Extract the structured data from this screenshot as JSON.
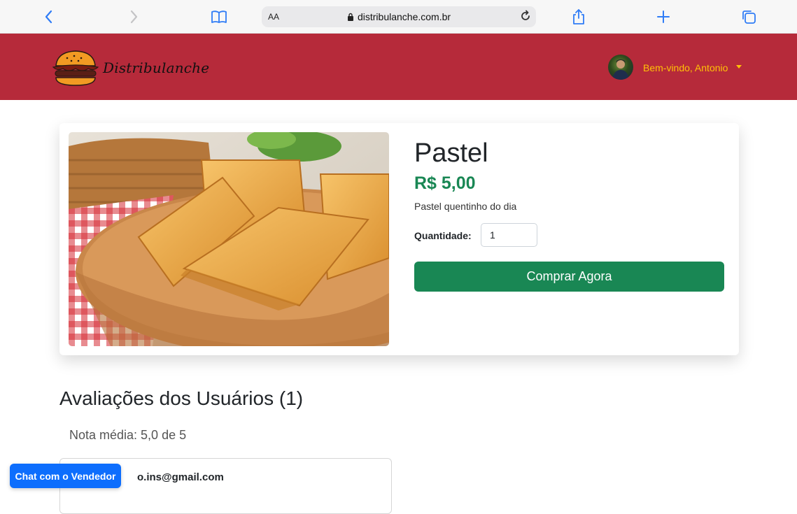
{
  "browser": {
    "url": "distribulanche.com.br",
    "aa_label": "AA",
    "icons": [
      "back-icon",
      "forward-icon",
      "bookmarks-icon",
      "lock-icon",
      "reload-icon",
      "share-icon",
      "new-tab-icon",
      "tabs-icon"
    ]
  },
  "header": {
    "brand": "Distribulanche",
    "greeting": "Bem-vindo, Antonio",
    "colors": {
      "background": "#b62a3a",
      "greeting": "#ffc107"
    }
  },
  "product": {
    "title": "Pastel",
    "price": "R$ 5,00",
    "description": "Pastel quentinho do dia",
    "quantity_label": "Quantidade:",
    "quantity_value": "1",
    "buy_label": "Comprar Agora",
    "colors": {
      "price": "#198754",
      "buy_button": "#198754"
    }
  },
  "reviews": {
    "title": "Avaliações dos Usuários (1)",
    "average": "Nota média: 5,0 de 5",
    "items": [
      {
        "author": "o.ins@gmail.com"
      }
    ]
  },
  "chat": {
    "label": "Chat com o Vendedor",
    "color": "#0d6efd"
  }
}
